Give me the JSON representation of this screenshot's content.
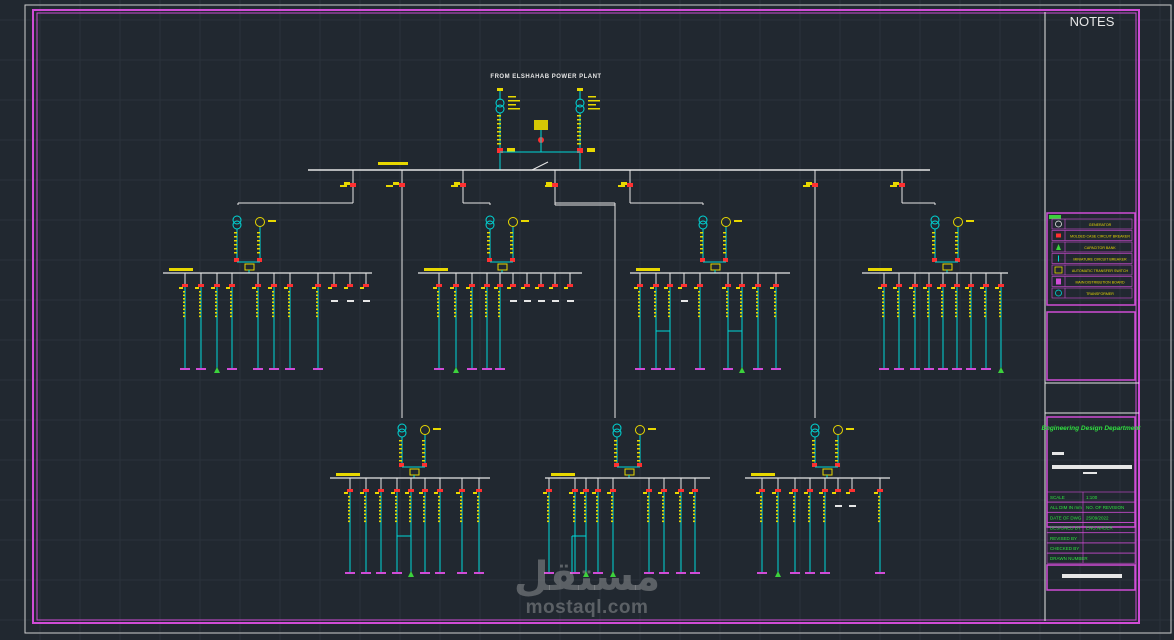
{
  "sheet": {
    "notes_title": "NOTES",
    "plant_title": "FROM ELSHAHAB POWER PLANT",
    "department": "Engineering Design Department"
  },
  "legend": {
    "items": [
      {
        "label": "GENERATOR",
        "icon": "generator-icon"
      },
      {
        "label": "MOLDED CASE CIRCUIT BREAKER",
        "icon": "breaker-icon"
      },
      {
        "label": "CAPACITOR BANK",
        "icon": "capacitor-icon"
      },
      {
        "label": "MINIATURE CIRCUIT BREAKER",
        "icon": "mcb-icon"
      },
      {
        "label": "AUTOMATIC TRANSFER SWITCH",
        "icon": "ats-icon"
      },
      {
        "label": "MAIN DISTRIBUTION BOARD",
        "icon": "mdb-icon"
      },
      {
        "label": "TRANSFORMER",
        "icon": "transformer-icon"
      }
    ]
  },
  "title_block": {
    "rows": [
      {
        "label": "SCALE",
        "value": "1:100"
      },
      {
        "label": "ALL DIM IN mm",
        "value": "NO. OF REVISION"
      },
      {
        "label": "DATE OF DWG",
        "value": "25/09/2022"
      },
      {
        "label": "DESIGNED BY",
        "value": "ENG.NADER"
      },
      {
        "label": "REVISED BY",
        "value": ""
      },
      {
        "label": "CHECKED BY",
        "value": ""
      },
      {
        "label": "DRAWN NUMBER",
        "value": ""
      }
    ]
  },
  "watermark": {
    "arabic": "مستقل",
    "latin": "mostaql.com"
  },
  "colors": {
    "background": "#212830",
    "frame": "#d04cd6",
    "busbar": "#e6e6e6",
    "conductor": "#00d7d7",
    "label": "#e8d800",
    "breaker": "#ff3030",
    "capacitor": "#3cd23c",
    "title_text": "#30e040"
  }
}
